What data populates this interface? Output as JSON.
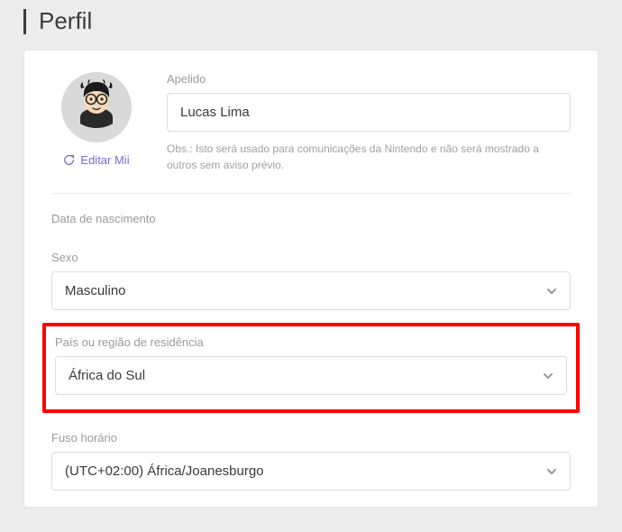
{
  "page": {
    "title": "Perfil"
  },
  "avatar": {
    "edit_label": "Editar Mii"
  },
  "nickname": {
    "label": "Apelido",
    "value": "Lucas Lima",
    "hint": "Obs.: Isto será usado para comunicações da Nintendo e não será mostrado a outros sem aviso prévio."
  },
  "dob": {
    "label": "Data de nascimento"
  },
  "gender": {
    "label": "Sexo",
    "value": "Masculino"
  },
  "country": {
    "label": "País ou região de residência",
    "value": "África do Sul"
  },
  "timezone": {
    "label": "Fuso horário",
    "value": "(UTC+02:00) África/Joanesburgo"
  }
}
